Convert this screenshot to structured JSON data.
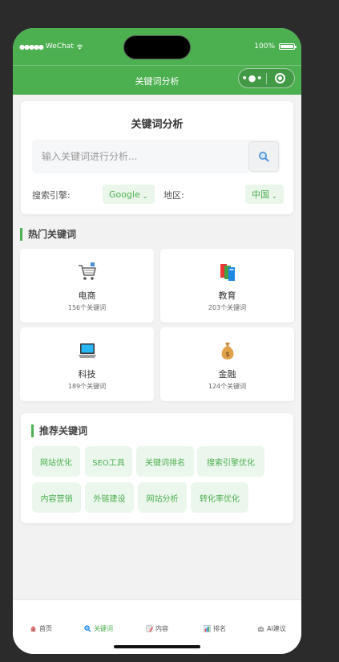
{
  "status_bar": {
    "carrier": "WeChat",
    "battery": "100%"
  },
  "nav": {
    "title": "关键词分析",
    "more_icon": "more-dots-icon",
    "close_icon": "target-close-icon"
  },
  "search_card": {
    "title": "关键词分析",
    "placeholder": "输入关键词进行分析...",
    "search_icon": "magnifier-icon",
    "engine_label": "搜索引擎:",
    "engine_value": "Google",
    "region_label": "地区:",
    "region_value": "中国"
  },
  "hot": {
    "title": "热门关键词",
    "categories": [
      {
        "name": "电商",
        "count": "156个关键词",
        "icon": "shopping-cart-icon"
      },
      {
        "name": "教育",
        "count": "203个关键词",
        "icon": "books-icon"
      },
      {
        "name": "科技",
        "count": "189个关键词",
        "icon": "laptop-icon"
      },
      {
        "name": "金融",
        "count": "124个关键词",
        "icon": "money-bag-icon"
      }
    ]
  },
  "recommended": {
    "title": "推荐关键词",
    "tags": [
      "网站优化",
      "SEO工具",
      "关键词排名",
      "搜索引擎优化",
      "内容营销",
      "外链建设",
      "网站分析",
      "转化率优化"
    ]
  },
  "tabbar": {
    "items": [
      {
        "label": "首页",
        "icon": "house-icon"
      },
      {
        "label": "关键词",
        "icon": "search-icon",
        "active": true
      },
      {
        "label": "内容",
        "icon": "memo-icon"
      },
      {
        "label": "排名",
        "icon": "bar-chart-icon"
      },
      {
        "label": "AI建议",
        "icon": "robot-icon"
      }
    ]
  },
  "colors": {
    "primary": "#4caf50",
    "tag_bg": "#ebf7ec",
    "background": "#f2f2f2"
  }
}
